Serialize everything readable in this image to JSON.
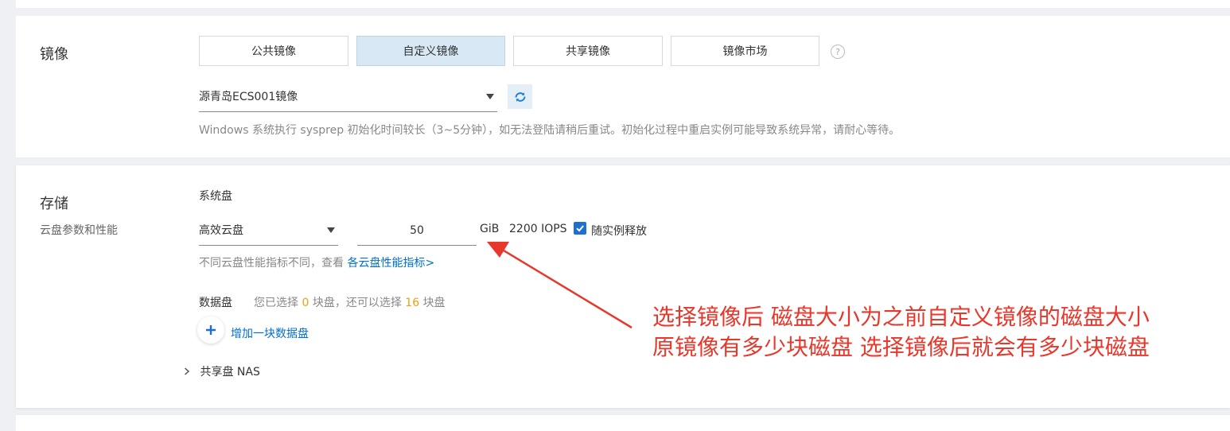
{
  "image_section": {
    "title": "镜像",
    "tabs": [
      {
        "label": "公共镜像",
        "active": false
      },
      {
        "label": "自定义镜像",
        "active": true
      },
      {
        "label": "共享镜像",
        "active": false
      },
      {
        "label": "镜像市场",
        "active": false
      }
    ],
    "help_icon": "question-circle-icon",
    "selected_image": "源青岛ECS001镜像",
    "refresh_icon": "refresh-icon",
    "hint": "Windows 系统执行 sysprep 初始化时间较长（3~5分钟），如无法登陆请稍后重试。初始化过程中重启实例可能导致系统异常，请耐心等待。"
  },
  "storage_section": {
    "title": "存储",
    "subtitle": "云盘参数和性能",
    "system_disk": {
      "label": "系统盘",
      "type": "高效云盘",
      "size": "50",
      "unit": "GiB",
      "iops": "2200 IOPS",
      "release_checkbox_label": "随实例释放",
      "release_checked": true,
      "perf_hint_prefix": "不同云盘性能指标不同，查看",
      "perf_link": "各云盘性能指标>"
    },
    "data_disk": {
      "label": "数据盘",
      "hint_prefix": "您已选择",
      "selected_count": "0",
      "hint_middle": "块盘，还可以选择",
      "remaining_count": "16",
      "hint_suffix": "块盘",
      "add_button": "增加一块数据盘"
    },
    "shared_disk": {
      "label": "共享盘 NAS",
      "expand_icon": "chevron-right-icon"
    }
  },
  "annotation": {
    "line1": "选择镜像后 磁盘大小为之前自定义镜像的磁盘大小",
    "line2": "原镜像有多少块磁盘  选择镜像后就会有多少块磁盘",
    "color": "#e8372b"
  },
  "colors": {
    "accent": "#0070cc",
    "active_tab_bg": "#d8e8f5",
    "checkbox": "#1e6fd0",
    "count_highlight": "#f39c12"
  }
}
